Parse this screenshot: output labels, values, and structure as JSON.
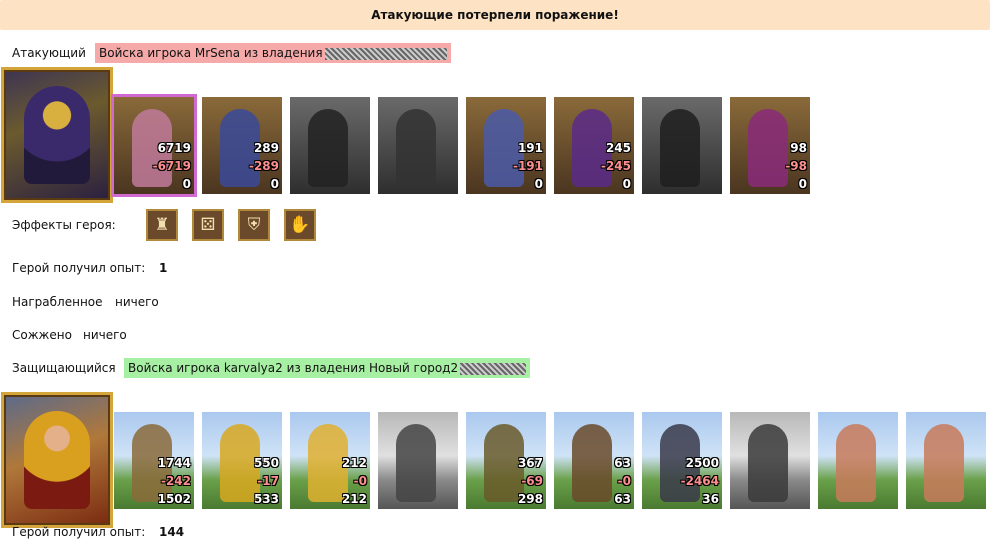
{
  "banner": "Атакующие потерпели поражение!",
  "attacker": {
    "label": "Атакующий",
    "army": "Войска игрока MrSena из владения",
    "units": [
      {
        "c": "6719",
        "l": "-6719",
        "s": "0",
        "style": "sel",
        "fig": "#c07a9a"
      },
      {
        "c": "289",
        "l": "-289",
        "s": "0",
        "style": "",
        "fig": "#3a4a9a"
      },
      {
        "c": "",
        "l": "",
        "s": "",
        "style": "grey",
        "fig": "#222"
      },
      {
        "c": "",
        "l": "",
        "s": "",
        "style": "grey",
        "fig": "#333"
      },
      {
        "c": "191",
        "l": "-191",
        "s": "0",
        "style": "",
        "fig": "#4a5aa8"
      },
      {
        "c": "245",
        "l": "-245",
        "s": "0",
        "style": "",
        "fig": "#5a2a8a"
      },
      {
        "c": "",
        "l": "",
        "s": "",
        "style": "grey",
        "fig": "#1e1e1e"
      },
      {
        "c": "98",
        "l": "-98",
        "s": "0",
        "style": "",
        "fig": "#8a2a7a"
      }
    ],
    "effects_label": "Эффекты героя:",
    "effects": [
      "castle-icon",
      "dice-icon",
      "shield-icon",
      "handshake-icon"
    ],
    "exp_label": "Герой получил опыт:",
    "exp_value": "1",
    "loot_label": "Награбленное",
    "loot_value": "ничего",
    "burned_label": "Сожжено",
    "burned_value": "ничего"
  },
  "defender": {
    "label": "Защищающийся",
    "army": "Войска игрока karvalya2 из владения Новый город2",
    "units": [
      {
        "c": "1744",
        "l": "-242",
        "s": "1502",
        "style": "field",
        "fig": "#8a6a3a"
      },
      {
        "c": "550",
        "l": "-17",
        "s": "533",
        "style": "field",
        "fig": "#d8a820"
      },
      {
        "c": "212",
        "l": "-0",
        "s": "212",
        "style": "field",
        "fig": "#e0b030"
      },
      {
        "c": "",
        "l": "",
        "s": "",
        "style": "fieldgrey",
        "fig": "#444"
      },
      {
        "c": "367",
        "l": "-69",
        "s": "298",
        "style": "field",
        "fig": "#6a5a2a"
      },
      {
        "c": "63",
        "l": "-0",
        "s": "63",
        "style": "field",
        "fig": "#6a4a2a"
      },
      {
        "c": "2500",
        "l": "-2464",
        "s": "36",
        "style": "field",
        "fig": "#3a3a4a"
      },
      {
        "c": "",
        "l": "",
        "s": "",
        "style": "fieldgrey",
        "fig": "#3a3a3a"
      },
      {
        "c": "",
        "l": "",
        "s": "",
        "style": "field",
        "fig": "#c87a5a"
      },
      {
        "c": "",
        "l": "",
        "s": "",
        "style": "field",
        "fig": "#c87a5a"
      }
    ],
    "exp_label": "Герой получил опыт:",
    "exp_value": "144"
  }
}
